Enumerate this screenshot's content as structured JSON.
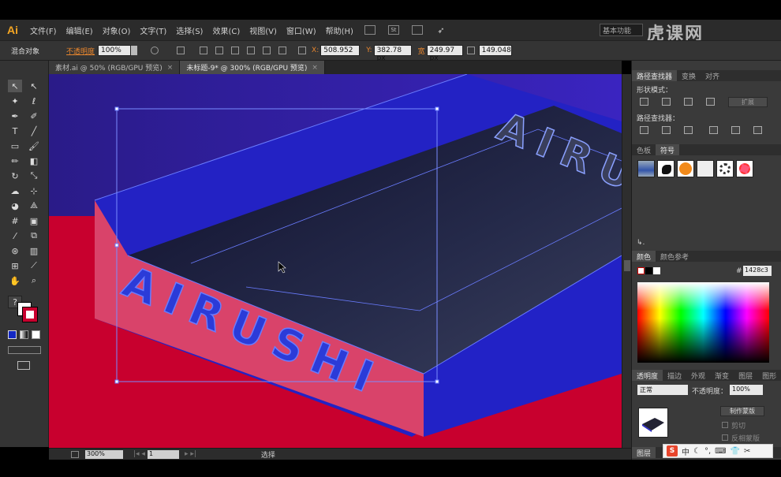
{
  "app": {
    "logo": "Ai",
    "workspace": "基本功能",
    "watermark": "虎课网"
  },
  "menu": [
    "文件(F)",
    "编辑(E)",
    "对象(O)",
    "文字(T)",
    "选择(S)",
    "效果(C)",
    "视图(V)",
    "窗口(W)",
    "帮助(H)"
  ],
  "menubar_icons": [
    "St"
  ],
  "control": {
    "object_type": "混合对象",
    "opacity_label": "不透明度",
    "opacity_value": "100%",
    "x_label": "X:",
    "x_value": "508.952",
    "y_label": "Y:",
    "y_value": "382.78 px",
    "w_label": "宽",
    "w_value": "249.97 px",
    "h_value": "149.048"
  },
  "tabs": [
    {
      "label": "素材.ai @ 50% (RGB/GPU 预览)",
      "close": "×"
    },
    {
      "label": "未标题-9* @ 300% (RGB/GPU 预览)",
      "close": "×"
    }
  ],
  "toolbar": {
    "tools": [
      "selection-tool",
      "direct-selection-tool",
      "magic-wand-tool",
      "lasso-tool",
      "pen-tool",
      "curvature-tool",
      "type-tool",
      "line-tool",
      "rectangle-tool",
      "paintbrush-tool",
      "pencil-tool",
      "eraser-tool",
      "rotate-tool",
      "scale-tool",
      "warp-tool",
      "free-transform-tool",
      "shape-builder-tool",
      "perspective-tool",
      "mesh-tool",
      "gradient-tool",
      "eyedropper-tool",
      "blend-tool",
      "symbol-sprayer-tool",
      "graph-tool",
      "artboard-tool",
      "slice-tool",
      "hand-tool",
      "zoom-tool"
    ],
    "help_glyph": "?"
  },
  "canvas": {
    "text": "AIRUSHI",
    "colors": {
      "background_blue": "#2a1fa8",
      "red": "#c8002e",
      "pink_side": "#d9436a",
      "dark_top": "#1a1a3a",
      "blue_side": "#2424c8",
      "selection": "#6a7cff"
    }
  },
  "status": {
    "zoom": "300%",
    "artboard": "1",
    "mode": "选择"
  },
  "panels": {
    "pathfinder_tabs": [
      "路径查找器",
      "变换",
      "对齐"
    ],
    "shape_modes_label": "形状模式：",
    "expand_button": "扩展",
    "pathfinders_label": "路径查找器：",
    "swatch_tabs": [
      "色板",
      "符号"
    ],
    "color_tabs": [
      "颜色",
      "颜色参考"
    ],
    "hex_label": "#",
    "hex_value": "1428c3",
    "transparency_tabs": [
      "透明度",
      "描边",
      "外观",
      "渐变",
      "图层",
      "图形"
    ],
    "blend_mode": "正常",
    "opacity_label": "不透明度：",
    "opacity_value": "100%",
    "make_mask_button": "制作蒙版",
    "clip_label": "剪切",
    "invert_label": "反相蒙版",
    "layers_tab": "图层"
  },
  "ime": {
    "logo": "S",
    "lang": "中"
  }
}
